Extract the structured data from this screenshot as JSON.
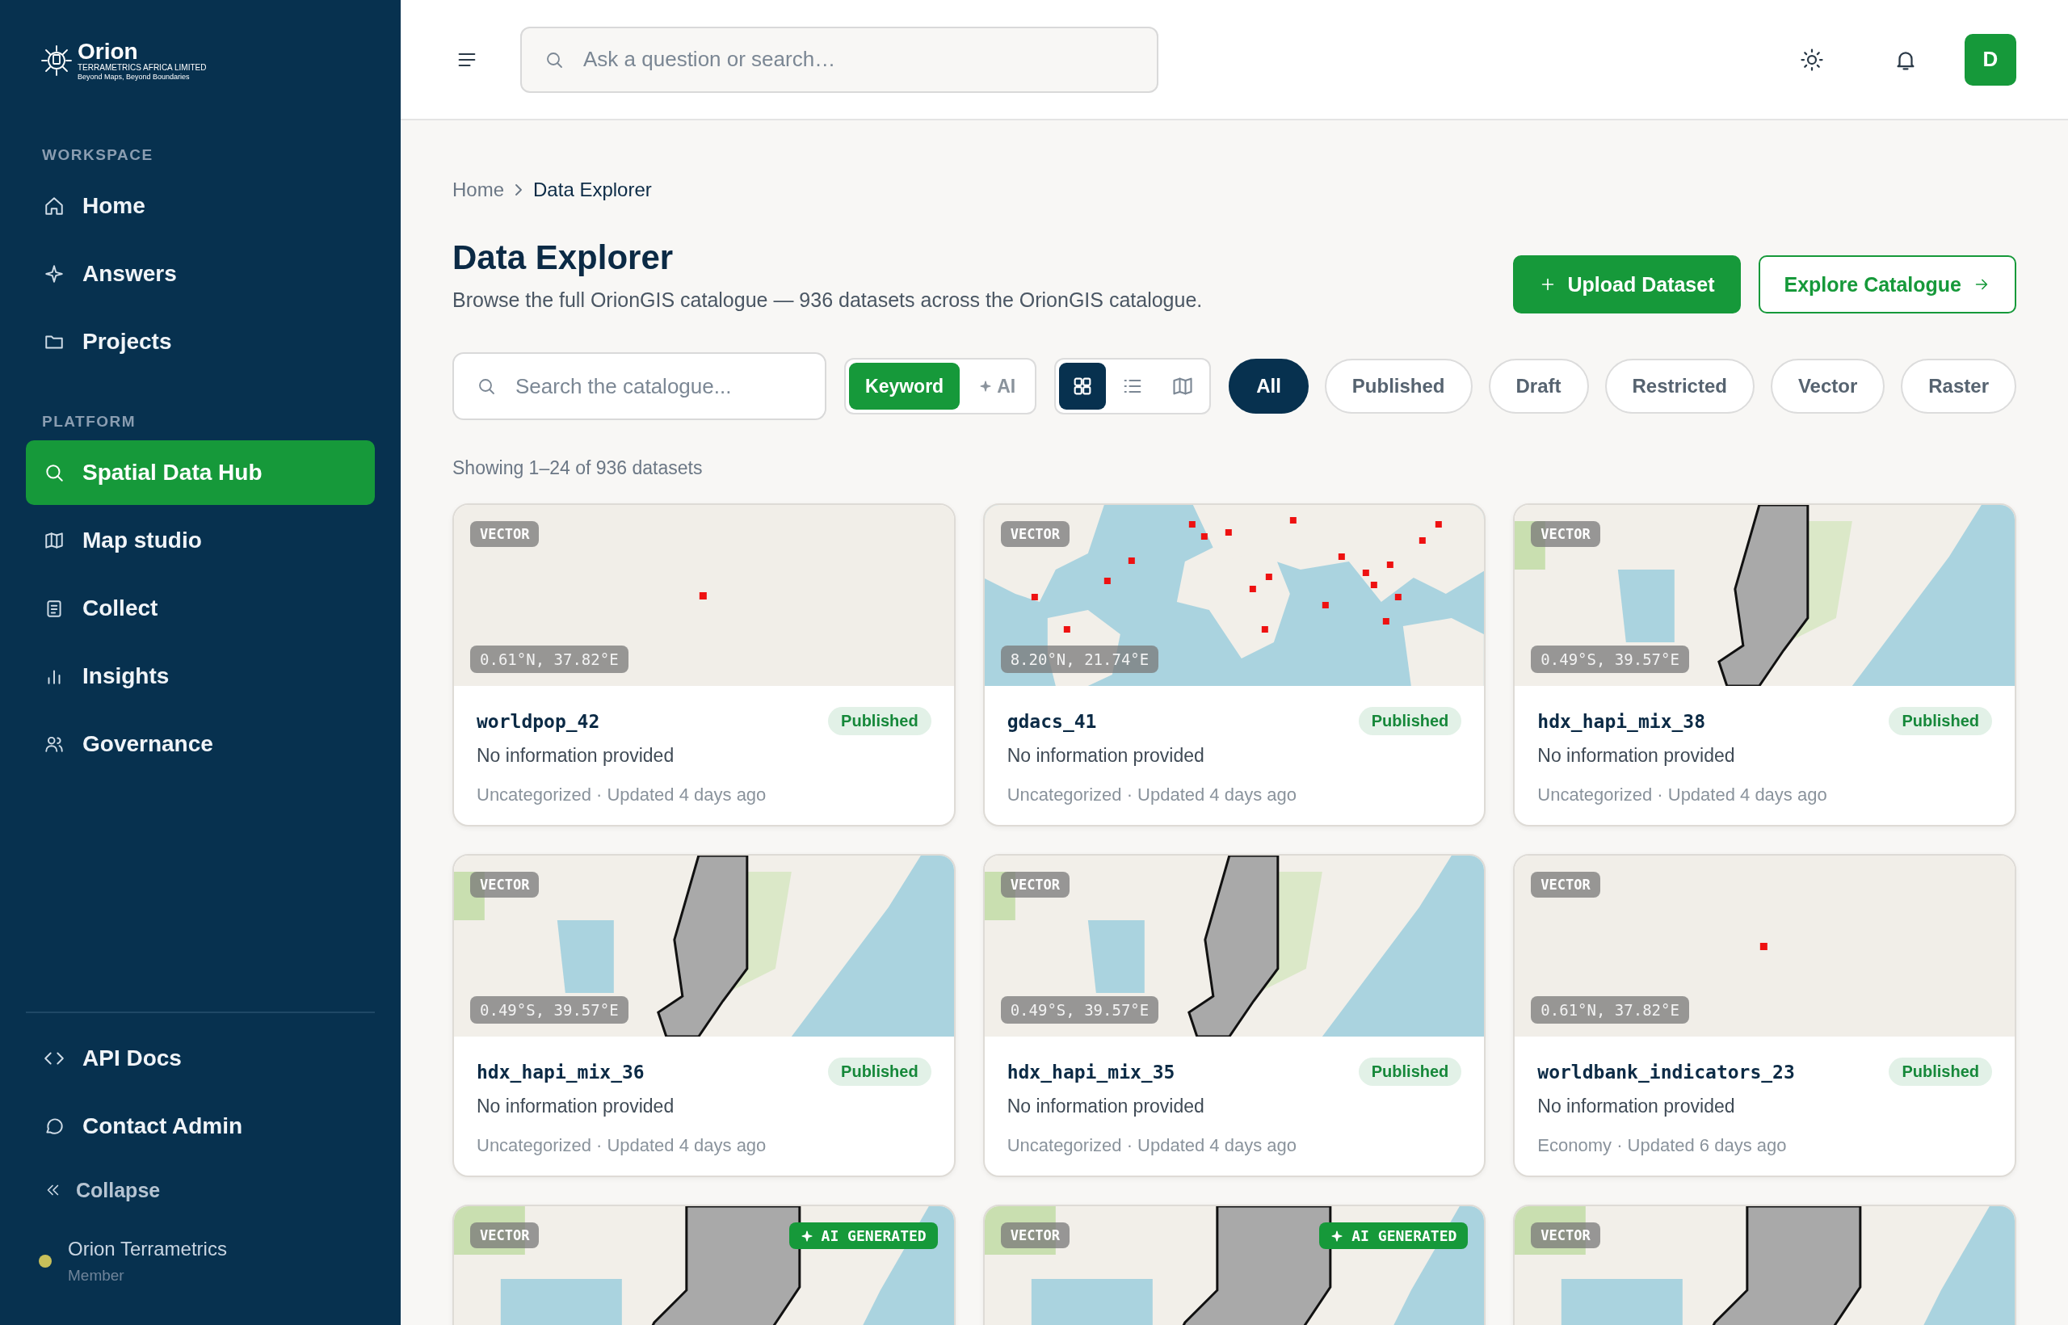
{
  "sidebar": {
    "logo": {
      "name": "Orion",
      "tagline": "TERRAMETRICS AFRICA LIMITED",
      "motto": "Beyond Maps, Beyond Boundaries"
    },
    "sections": [
      {
        "heading": "WORKSPACE",
        "items": [
          {
            "label": "Home",
            "selected": false
          },
          {
            "label": "Answers",
            "selected": false
          },
          {
            "label": "Projects",
            "selected": false
          }
        ]
      },
      {
        "heading": "PLATFORM",
        "items": [
          {
            "label": "Spatial Data Hub",
            "selected": true
          },
          {
            "label": "Map studio",
            "selected": false
          },
          {
            "label": "Collect",
            "selected": false
          },
          {
            "label": "Insights",
            "selected": false
          },
          {
            "label": "Governance",
            "selected": false
          }
        ]
      }
    ],
    "footer_items": [
      {
        "label": "API Docs"
      },
      {
        "label": "Contact Admin"
      }
    ],
    "collapse": {
      "label": "Collapse"
    },
    "user": {
      "name": "Orion Terrametrics",
      "role": "Member",
      "color": "#c8c05a"
    }
  },
  "header": {
    "search": {
      "placeholder": "Ask a question or search…"
    },
    "avatar": "D"
  },
  "breadcrumb": [
    "Home",
    "Data Explorer"
  ],
  "page": {
    "title": "Data Explorer",
    "subtitle": "Browse the full OrionGIS catalogue — 936 datasets across the OrionGIS catalogue.",
    "buttons": [
      {
        "label": "Upload Dataset",
        "kind": "primary"
      },
      {
        "label": "Explore Catalogue",
        "kind": "outline"
      }
    ]
  },
  "filters": {
    "search": {
      "placeholder": "Search the catalogue..."
    },
    "modes": [
      {
        "label": "Keyword",
        "selected": true
      },
      {
        "label": "AI",
        "selected": false
      }
    ],
    "views": [
      {
        "selected": true
      },
      {
        "selected": false
      },
      {
        "selected": false
      }
    ],
    "chips": [
      {
        "label": "All",
        "selected": true
      },
      {
        "label": "Published",
        "selected": false
      },
      {
        "label": "Draft",
        "selected": false
      },
      {
        "label": "Restricted",
        "selected": false
      },
      {
        "label": "Vector",
        "selected": false
      },
      {
        "label": "Raster",
        "selected": false
      }
    ]
  },
  "results": {
    "summary": "Showing 1–24 of 936 datasets"
  },
  "datasets": [
    {
      "type": "VECTOR",
      "coords": "0.61°N, 37.82°E",
      "name": "worldpop_42",
      "status": "Published",
      "description": "No information provided",
      "meta": "Uncategorized · Updated 4 days ago"
    },
    {
      "type": "VECTOR",
      "coords": "8.20°N, 21.74°E",
      "name": "gdacs_41",
      "status": "Published",
      "description": "No information provided",
      "meta": "Uncategorized · Updated 4 days ago"
    },
    {
      "type": "VECTOR",
      "coords": "0.49°S, 39.57°E",
      "name": "hdx_hapi_mix_38",
      "status": "Published",
      "description": "No information provided",
      "meta": "Uncategorized · Updated 4 days ago"
    },
    {
      "type": "VECTOR",
      "coords": "0.49°S, 39.57°E",
      "name": "hdx_hapi_mix_36",
      "status": "Published",
      "description": "No information provided",
      "meta": "Uncategorized · Updated 4 days ago"
    },
    {
      "type": "VECTOR",
      "coords": "0.49°S, 39.57°E",
      "name": "hdx_hapi_mix_35",
      "status": "Published",
      "description": "No information provided",
      "meta": "Uncategorized · Updated 4 days ago"
    },
    {
      "type": "VECTOR",
      "coords": "0.61°N, 37.82°E",
      "name": "worldbank_indicators_23",
      "status": "Published",
      "description": "No information provided",
      "meta": "Economy · Updated 6 days ago"
    },
    {
      "type": "VECTOR",
      "ai_label": "AI GENERATED"
    },
    {
      "type": "VECTOR",
      "ai_label": "AI GENERATED"
    },
    {
      "type": "VECTOR"
    }
  ]
}
